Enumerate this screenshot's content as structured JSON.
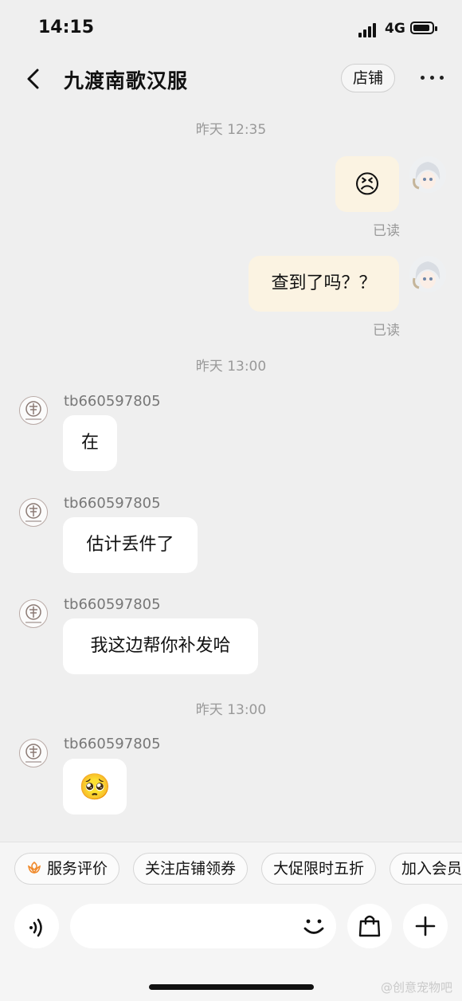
{
  "status_bar": {
    "time": "14:15",
    "network": "4G",
    "battery_level": 0.9
  },
  "header": {
    "title": "九渡南歌汉服",
    "shop_button": "店铺"
  },
  "messages": {
    "ts1": "昨天 12:35",
    "m1_emoji": "😣",
    "m1_read": "已读",
    "m2_text": "查到了吗？？",
    "m2_read": "已读",
    "ts2": "昨天 13:00",
    "shop_name": "tb660597805",
    "r1_text": "在",
    "r2_text": "估计丢件了",
    "r3_text": "我这边帮你补发哈",
    "ts3": "昨天 13:00",
    "r4_emoji": "🥺"
  },
  "shortcuts": {
    "service_review": "服务评价",
    "follow_coupon": "关注店铺领券",
    "sale": "大促限时五折",
    "join_member": "加入会员"
  },
  "watermark": "@创意宠物吧"
}
